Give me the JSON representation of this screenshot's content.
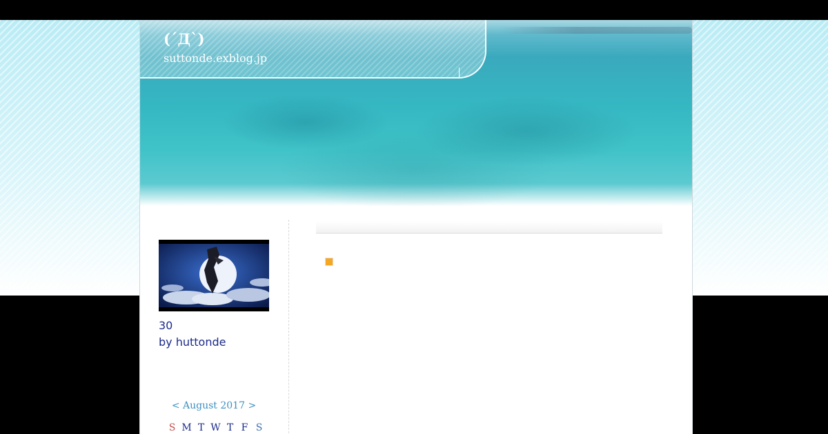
{
  "header": {
    "site_title": "(´Д`)",
    "site_url": "suttonde.exblog.jp"
  },
  "profile": {
    "name": "30",
    "by_line": "by huttonde"
  },
  "calendar": {
    "prev": "<",
    "month_label": "August 2017",
    "next": ">",
    "weekdays": [
      "S",
      "M",
      "T",
      "W",
      "T",
      "F",
      "S"
    ]
  },
  "colors": {
    "link": "#1a2a8a",
    "calendar_nav": "#3d8fc0",
    "bullet": "#f5a623"
  }
}
